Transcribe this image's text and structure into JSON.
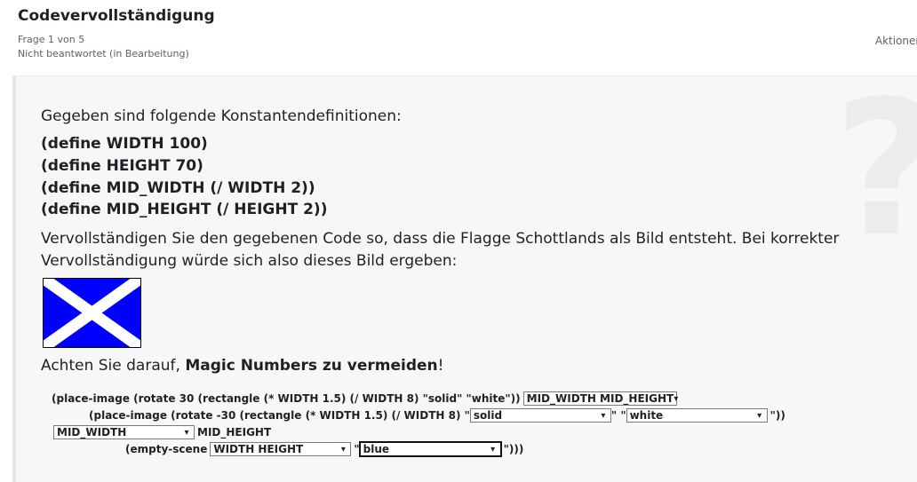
{
  "header": {
    "title": "Codevervollständigung",
    "question_number": "Frage 1 von 5",
    "status": "Nicht beantwortet (in Bearbeitung)",
    "actions_label": "Aktionen"
  },
  "question": {
    "intro": "Gegeben sind folgende Konstantendefinitionen:",
    "definitions": [
      "(define WIDTH 100)",
      "(define HEIGHT 70)",
      "(define MID_WIDTH (/ WIDTH 2))",
      "(define MID_HEIGHT (/ HEIGHT 2))"
    ],
    "instruction_line1": "Vervollständigen Sie den gegebenen Code so, dass die Flagge Schottlands als Bild entsteht. Bei korrekter",
    "instruction_line2": "Vervollständigung würde sich also dieses Bild ergeben:",
    "note_prefix": "Achten Sie darauf, ",
    "note_bold": "Magic Numbers zu vermeiden",
    "note_suffix": "!",
    "flag_colors": {
      "field": "#0000ff",
      "saltire": "#ffffff",
      "border": "#000000"
    }
  },
  "code": {
    "line1_text": "(place-image (rotate 30 (rectangle (* WIDTH 1.5) (/ WIDTH 8) \"solid\" \"white\"))",
    "select1_value": "MID_WIDTH MID_HEIGHT",
    "line2_text": "(place-image (rotate -30 (rectangle (* WIDTH 1.5) (/ WIDTH 8) \"",
    "select2_value": "solid",
    "line2_mid": "\" \"",
    "select3_value": "white",
    "line2_end": "\"))",
    "select4_value": "MID_WIDTH",
    "line3_text": "MID_HEIGHT",
    "line4_text": "(empty-scene",
    "select5_value": "WIDTH HEIGHT",
    "line4_mid": "\"",
    "select6_value": "blue",
    "line4_end": "\")))"
  },
  "icons": {
    "background_icon": "question-mark-icon",
    "dropdown_icon": "chevron-down-icon"
  }
}
